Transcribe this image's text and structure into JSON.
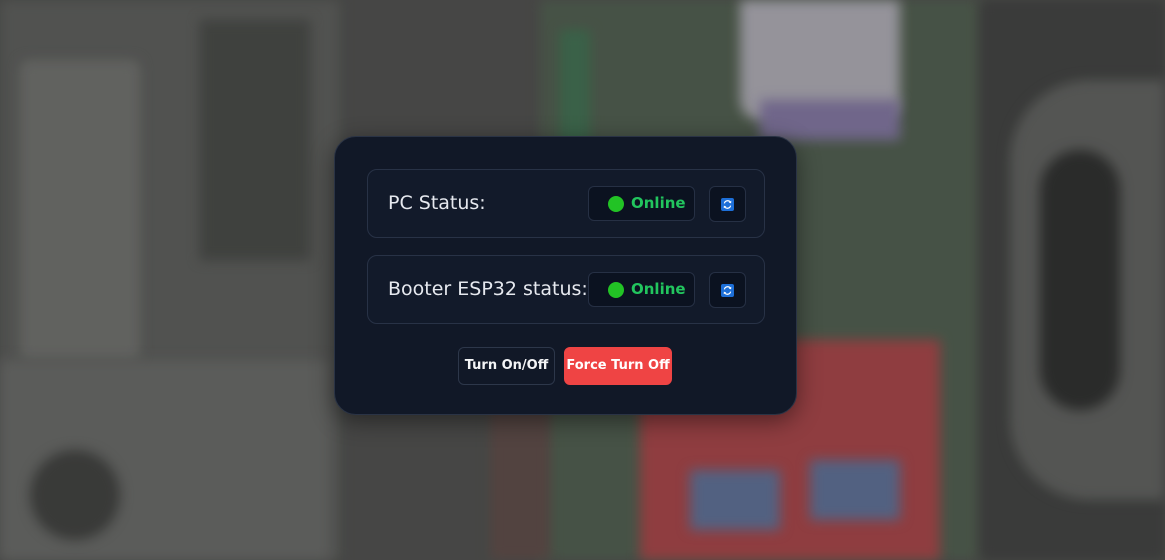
{
  "rows": [
    {
      "label": "PC Status:",
      "status": "Online",
      "status_color": "#22c55e",
      "refresh_icon": "refresh-icon"
    },
    {
      "label": "Booter ESP32 status:",
      "status": "Online",
      "status_color": "#22c55e",
      "refresh_icon": "refresh-icon"
    }
  ],
  "actions": {
    "toggle_label": "Turn On/Off",
    "force_off_label": "Force Turn Off",
    "force_off_color": "#ef4444"
  }
}
